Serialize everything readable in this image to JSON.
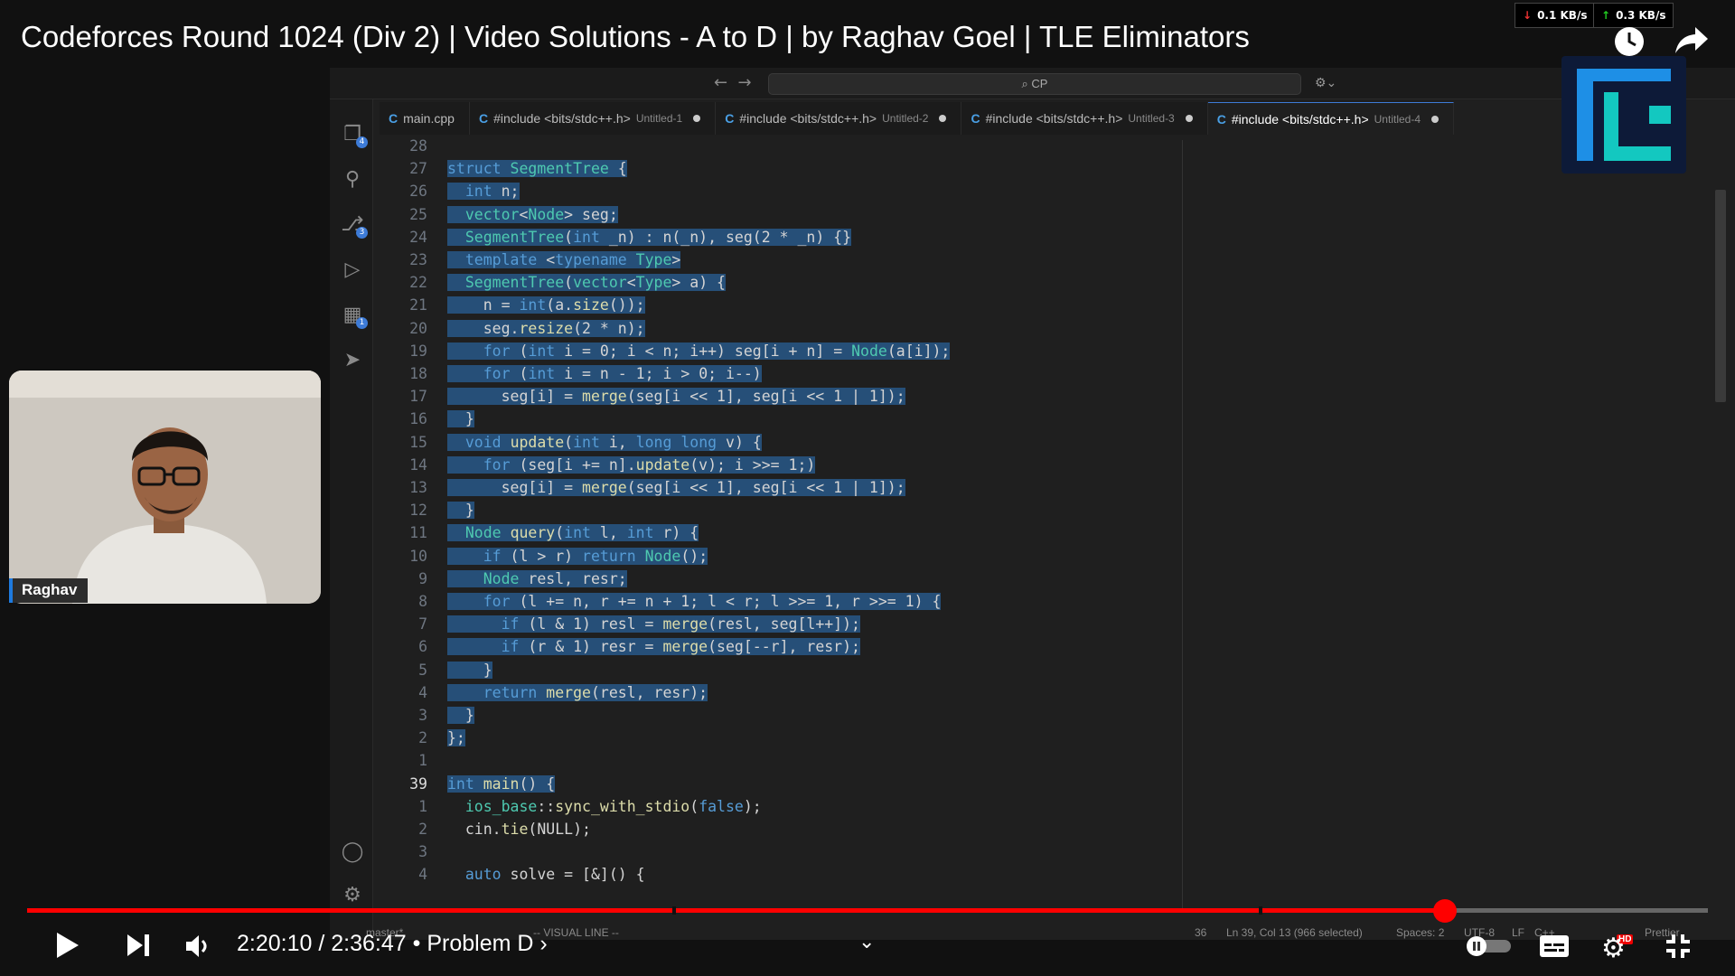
{
  "video": {
    "title": "Codeforces Round 1024 (Div 2) | Video Solutions - A to D | by Raghav Goel | TLE Eliminators",
    "webcam_name": "Raghav"
  },
  "network": {
    "download": "0.1 KB/s",
    "upload": "0.3 KB/s"
  },
  "vscode": {
    "command_center": "CP",
    "tabs": [
      {
        "label": "main.cpp",
        "sub": "",
        "dirty": false,
        "active": false
      },
      {
        "label": "#include <bits/stdc++.h>",
        "sub": "Untitled-1",
        "dirty": true,
        "active": false
      },
      {
        "label": "#include <bits/stdc++.h>",
        "sub": "Untitled-2",
        "dirty": true,
        "active": false
      },
      {
        "label": "#include <bits/stdc++.h>",
        "sub": "Untitled-3",
        "dirty": true,
        "active": false
      },
      {
        "label": "#include <bits/stdc++.h>",
        "sub": "Untitled-4",
        "dirty": true,
        "active": true
      }
    ],
    "code_lines": [
      {
        "n": "28",
        "text": "",
        "sel": true
      },
      {
        "n": "27",
        "text": "struct SegmentTree {",
        "sel": true
      },
      {
        "n": "26",
        "text": "  int n;",
        "sel": true
      },
      {
        "n": "25",
        "text": "  vector<Node> seg;",
        "sel": true
      },
      {
        "n": "24",
        "text": "  SegmentTree(int _n) : n(_n), seg(2 * _n) {}",
        "sel": true
      },
      {
        "n": "23",
        "text": "  template <typename Type>",
        "sel": true
      },
      {
        "n": "22",
        "text": "  SegmentTree(vector<Type> a) {",
        "sel": true
      },
      {
        "n": "21",
        "text": "    n = int(a.size());",
        "sel": true
      },
      {
        "n": "20",
        "text": "    seg.resize(2 * n);",
        "sel": true
      },
      {
        "n": "19",
        "text": "    for (int i = 0; i < n; i++) seg[i + n] = Node(a[i]);",
        "sel": true
      },
      {
        "n": "18",
        "text": "    for (int i = n - 1; i > 0; i--)",
        "sel": true
      },
      {
        "n": "17",
        "text": "      seg[i] = merge(seg[i << 1], seg[i << 1 | 1]);",
        "sel": true
      },
      {
        "n": "16",
        "text": "  }",
        "sel": true
      },
      {
        "n": "15",
        "text": "  void update(int i, long long v) {",
        "sel": true
      },
      {
        "n": "14",
        "text": "    for (seg[i += n].update(v); i >>= 1;)",
        "sel": true
      },
      {
        "n": "13",
        "text": "      seg[i] = merge(seg[i << 1], seg[i << 1 | 1]);",
        "sel": true
      },
      {
        "n": "12",
        "text": "  }",
        "sel": true
      },
      {
        "n": "11",
        "text": "  Node query(int l, int r) {",
        "sel": true
      },
      {
        "n": "10",
        "text": "    if (l > r) return Node();",
        "sel": true
      },
      {
        "n": "9",
        "text": "    Node resl, resr;",
        "sel": true
      },
      {
        "n": "8",
        "text": "    for (l += n, r += n + 1; l < r; l >>= 1, r >>= 1) {",
        "sel": true
      },
      {
        "n": "7",
        "text": "      if (l & 1) resl = merge(resl, seg[l++]);",
        "sel": true
      },
      {
        "n": "6",
        "text": "      if (r & 1) resr = merge(seg[--r], resr);",
        "sel": true
      },
      {
        "n": "5",
        "text": "    }",
        "sel": true
      },
      {
        "n": "4",
        "text": "    return merge(resl, resr);",
        "sel": true
      },
      {
        "n": "3",
        "text": "  }",
        "sel": true
      },
      {
        "n": "2",
        "text": "};",
        "sel": true
      },
      {
        "n": "1",
        "text": "",
        "sel": false
      },
      {
        "n": "39",
        "text": "int main() {",
        "sel": true,
        "current": true
      },
      {
        "n": "1",
        "text": "  ios_base::sync_with_stdio(false);",
        "sel": false
      },
      {
        "n": "2",
        "text": "  cin.tie(NULL);",
        "sel": false
      },
      {
        "n": "3",
        "text": "",
        "sel": false
      },
      {
        "n": "4",
        "text": "  auto solve = [&]() {",
        "sel": false
      }
    ],
    "status": {
      "branch": "master*",
      "mode": "-- VISUAL LINE --",
      "count": "36",
      "position": "Ln 39, Col 13 (966 selected)",
      "spaces": "Spaces: 2",
      "encoding": "UTF-8",
      "eol": "LF",
      "language": "C++",
      "formatter": "Prettier"
    }
  },
  "player": {
    "time": "2:20:10 / 2:36:47",
    "chapter": "Problem D",
    "progress": 0.8436,
    "hd_badge": "HD"
  },
  "colors": {
    "accent": "#ff0000",
    "selection": "#264f78",
    "keyword": "#569cd6",
    "type": "#4ec9b0",
    "function": "#dcdcaa"
  }
}
